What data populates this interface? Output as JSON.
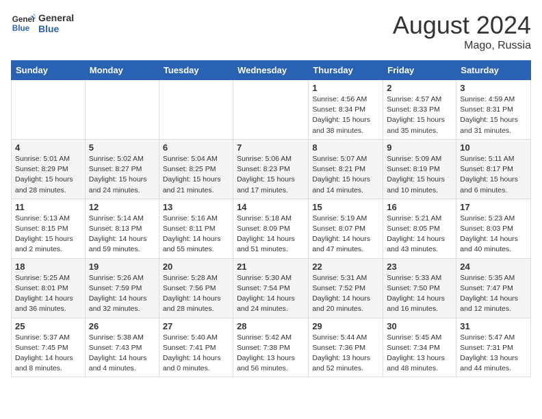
{
  "header": {
    "logo_line1": "General",
    "logo_line2": "Blue",
    "month": "August 2024",
    "location": "Mago, Russia"
  },
  "weekdays": [
    "Sunday",
    "Monday",
    "Tuesday",
    "Wednesday",
    "Thursday",
    "Friday",
    "Saturday"
  ],
  "weeks": [
    [
      {
        "day": "",
        "info": ""
      },
      {
        "day": "",
        "info": ""
      },
      {
        "day": "",
        "info": ""
      },
      {
        "day": "",
        "info": ""
      },
      {
        "day": "1",
        "info": "Sunrise: 4:56 AM\nSunset: 8:34 PM\nDaylight: 15 hours\nand 38 minutes."
      },
      {
        "day": "2",
        "info": "Sunrise: 4:57 AM\nSunset: 8:33 PM\nDaylight: 15 hours\nand 35 minutes."
      },
      {
        "day": "3",
        "info": "Sunrise: 4:59 AM\nSunset: 8:31 PM\nDaylight: 15 hours\nand 31 minutes."
      }
    ],
    [
      {
        "day": "4",
        "info": "Sunrise: 5:01 AM\nSunset: 8:29 PM\nDaylight: 15 hours\nand 28 minutes."
      },
      {
        "day": "5",
        "info": "Sunrise: 5:02 AM\nSunset: 8:27 PM\nDaylight: 15 hours\nand 24 minutes."
      },
      {
        "day": "6",
        "info": "Sunrise: 5:04 AM\nSunset: 8:25 PM\nDaylight: 15 hours\nand 21 minutes."
      },
      {
        "day": "7",
        "info": "Sunrise: 5:06 AM\nSunset: 8:23 PM\nDaylight: 15 hours\nand 17 minutes."
      },
      {
        "day": "8",
        "info": "Sunrise: 5:07 AM\nSunset: 8:21 PM\nDaylight: 15 hours\nand 14 minutes."
      },
      {
        "day": "9",
        "info": "Sunrise: 5:09 AM\nSunset: 8:19 PM\nDaylight: 15 hours\nand 10 minutes."
      },
      {
        "day": "10",
        "info": "Sunrise: 5:11 AM\nSunset: 8:17 PM\nDaylight: 15 hours\nand 6 minutes."
      }
    ],
    [
      {
        "day": "11",
        "info": "Sunrise: 5:13 AM\nSunset: 8:15 PM\nDaylight: 15 hours\nand 2 minutes."
      },
      {
        "day": "12",
        "info": "Sunrise: 5:14 AM\nSunset: 8:13 PM\nDaylight: 14 hours\nand 59 minutes."
      },
      {
        "day": "13",
        "info": "Sunrise: 5:16 AM\nSunset: 8:11 PM\nDaylight: 14 hours\nand 55 minutes."
      },
      {
        "day": "14",
        "info": "Sunrise: 5:18 AM\nSunset: 8:09 PM\nDaylight: 14 hours\nand 51 minutes."
      },
      {
        "day": "15",
        "info": "Sunrise: 5:19 AM\nSunset: 8:07 PM\nDaylight: 14 hours\nand 47 minutes."
      },
      {
        "day": "16",
        "info": "Sunrise: 5:21 AM\nSunset: 8:05 PM\nDaylight: 14 hours\nand 43 minutes."
      },
      {
        "day": "17",
        "info": "Sunrise: 5:23 AM\nSunset: 8:03 PM\nDaylight: 14 hours\nand 40 minutes."
      }
    ],
    [
      {
        "day": "18",
        "info": "Sunrise: 5:25 AM\nSunset: 8:01 PM\nDaylight: 14 hours\nand 36 minutes."
      },
      {
        "day": "19",
        "info": "Sunrise: 5:26 AM\nSunset: 7:59 PM\nDaylight: 14 hours\nand 32 minutes."
      },
      {
        "day": "20",
        "info": "Sunrise: 5:28 AM\nSunset: 7:56 PM\nDaylight: 14 hours\nand 28 minutes."
      },
      {
        "day": "21",
        "info": "Sunrise: 5:30 AM\nSunset: 7:54 PM\nDaylight: 14 hours\nand 24 minutes."
      },
      {
        "day": "22",
        "info": "Sunrise: 5:31 AM\nSunset: 7:52 PM\nDaylight: 14 hours\nand 20 minutes."
      },
      {
        "day": "23",
        "info": "Sunrise: 5:33 AM\nSunset: 7:50 PM\nDaylight: 14 hours\nand 16 minutes."
      },
      {
        "day": "24",
        "info": "Sunrise: 5:35 AM\nSunset: 7:47 PM\nDaylight: 14 hours\nand 12 minutes."
      }
    ],
    [
      {
        "day": "25",
        "info": "Sunrise: 5:37 AM\nSunset: 7:45 PM\nDaylight: 14 hours\nand 8 minutes."
      },
      {
        "day": "26",
        "info": "Sunrise: 5:38 AM\nSunset: 7:43 PM\nDaylight: 14 hours\nand 4 minutes."
      },
      {
        "day": "27",
        "info": "Sunrise: 5:40 AM\nSunset: 7:41 PM\nDaylight: 14 hours\nand 0 minutes."
      },
      {
        "day": "28",
        "info": "Sunrise: 5:42 AM\nSunset: 7:38 PM\nDaylight: 13 hours\nand 56 minutes."
      },
      {
        "day": "29",
        "info": "Sunrise: 5:44 AM\nSunset: 7:36 PM\nDaylight: 13 hours\nand 52 minutes."
      },
      {
        "day": "30",
        "info": "Sunrise: 5:45 AM\nSunset: 7:34 PM\nDaylight: 13 hours\nand 48 minutes."
      },
      {
        "day": "31",
        "info": "Sunrise: 5:47 AM\nSunset: 7:31 PM\nDaylight: 13 hours\nand 44 minutes."
      }
    ]
  ]
}
